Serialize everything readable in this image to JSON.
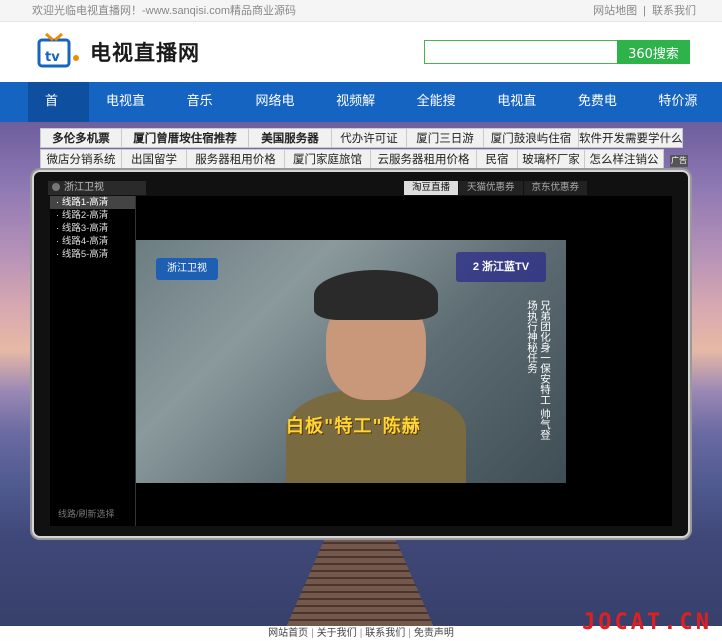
{
  "topbar": {
    "welcome": "欢迎光临电视直播网！-www.sanqisi.com精品商业源码",
    "sitemap": "网站地图",
    "contact": "联系我们"
  },
  "header": {
    "logo_text": "电视直播网",
    "search_placeholder": "",
    "search_button": "360搜索"
  },
  "nav": {
    "items": [
      "首 页",
      "电视直播",
      "音乐盒",
      "网络电台",
      "视频解析",
      "全能搜索",
      "电视直播",
      "免费电影",
      "特价源码"
    ]
  },
  "links": {
    "row1": [
      "多伦多机票",
      "厦门曾厝垵住宿推荐",
      "美国服务器",
      "代办许可证",
      "厦门三日游",
      "厦门鼓浪屿住宿",
      "软件开发需要学什么"
    ],
    "row2": [
      "微店分销系统",
      "出国留学",
      "服务器租用价格",
      "厦门家庭旅馆",
      "云服务器租用价格",
      "民宿",
      "玻璃杯厂家",
      "怎么样注销公"
    ],
    "close_label": "广告"
  },
  "player": {
    "channel_title": "浙江卫视",
    "lines": [
      "线路1-高清",
      "线路2-高清",
      "线路3-高清",
      "线路4-高清",
      "线路5-高清"
    ],
    "sidebar_footer": "线路/刷新选择",
    "tabs": [
      "淘豆直播",
      "天猫优惠券",
      "京东优惠券"
    ],
    "video_logo": "浙江卫视",
    "video_channel": "2 浙江蓝TV",
    "caption": "白板\"特工\"陈赫",
    "vertical_text": "兄弟团化身一保安特工 帅气登场执行神秘任务"
  },
  "footer": {
    "items": [
      "网站首页",
      "关于我们",
      "联系我们",
      "免责声明"
    ]
  },
  "watermark": "JOCAT.CN",
  "colors": {
    "nav": "#1664c2",
    "nav_active": "#0f4f9f",
    "search_button": "#2db34a"
  }
}
